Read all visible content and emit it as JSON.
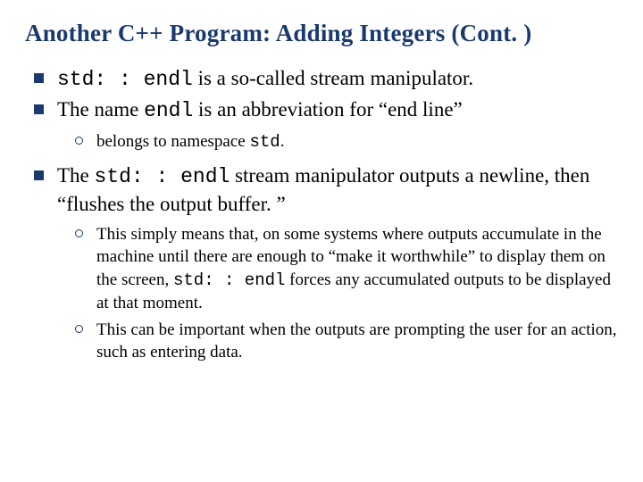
{
  "title": "Another C++ Program: Adding Integers (Cont. )",
  "items": [
    {
      "pre": "",
      "code1": "std: : endl",
      "mid": " is a so-called stream manipulator.",
      "code2": "",
      "post": ""
    },
    {
      "pre": "The name ",
      "code1": "endl",
      "mid": " is an abbreviation for “end line”",
      "code2": "",
      "post": "",
      "children": [
        {
          "pre": "belongs to namespace ",
          "code1": "std",
          "mid": ".",
          "code2": "",
          "post": ""
        }
      ]
    },
    {
      "pre": "The ",
      "code1": "std: : endl",
      "mid": " stream manipulator outputs a newline, then “flushes the output buffer. ”",
      "code2": "",
      "post": "",
      "children": [
        {
          "pre": "This simply means that, on some systems where outputs accumulate in the machine until there are enough to “make it worthwhile” to display them on the screen, ",
          "code1": "std: : endl",
          "mid": " forces any accumulated outputs to be displayed at that moment.",
          "code2": "",
          "post": ""
        },
        {
          "pre": "This can be important when the outputs are prompting the user for an action, such as entering data.",
          "code1": "",
          "mid": "",
          "code2": "",
          "post": ""
        }
      ]
    }
  ]
}
